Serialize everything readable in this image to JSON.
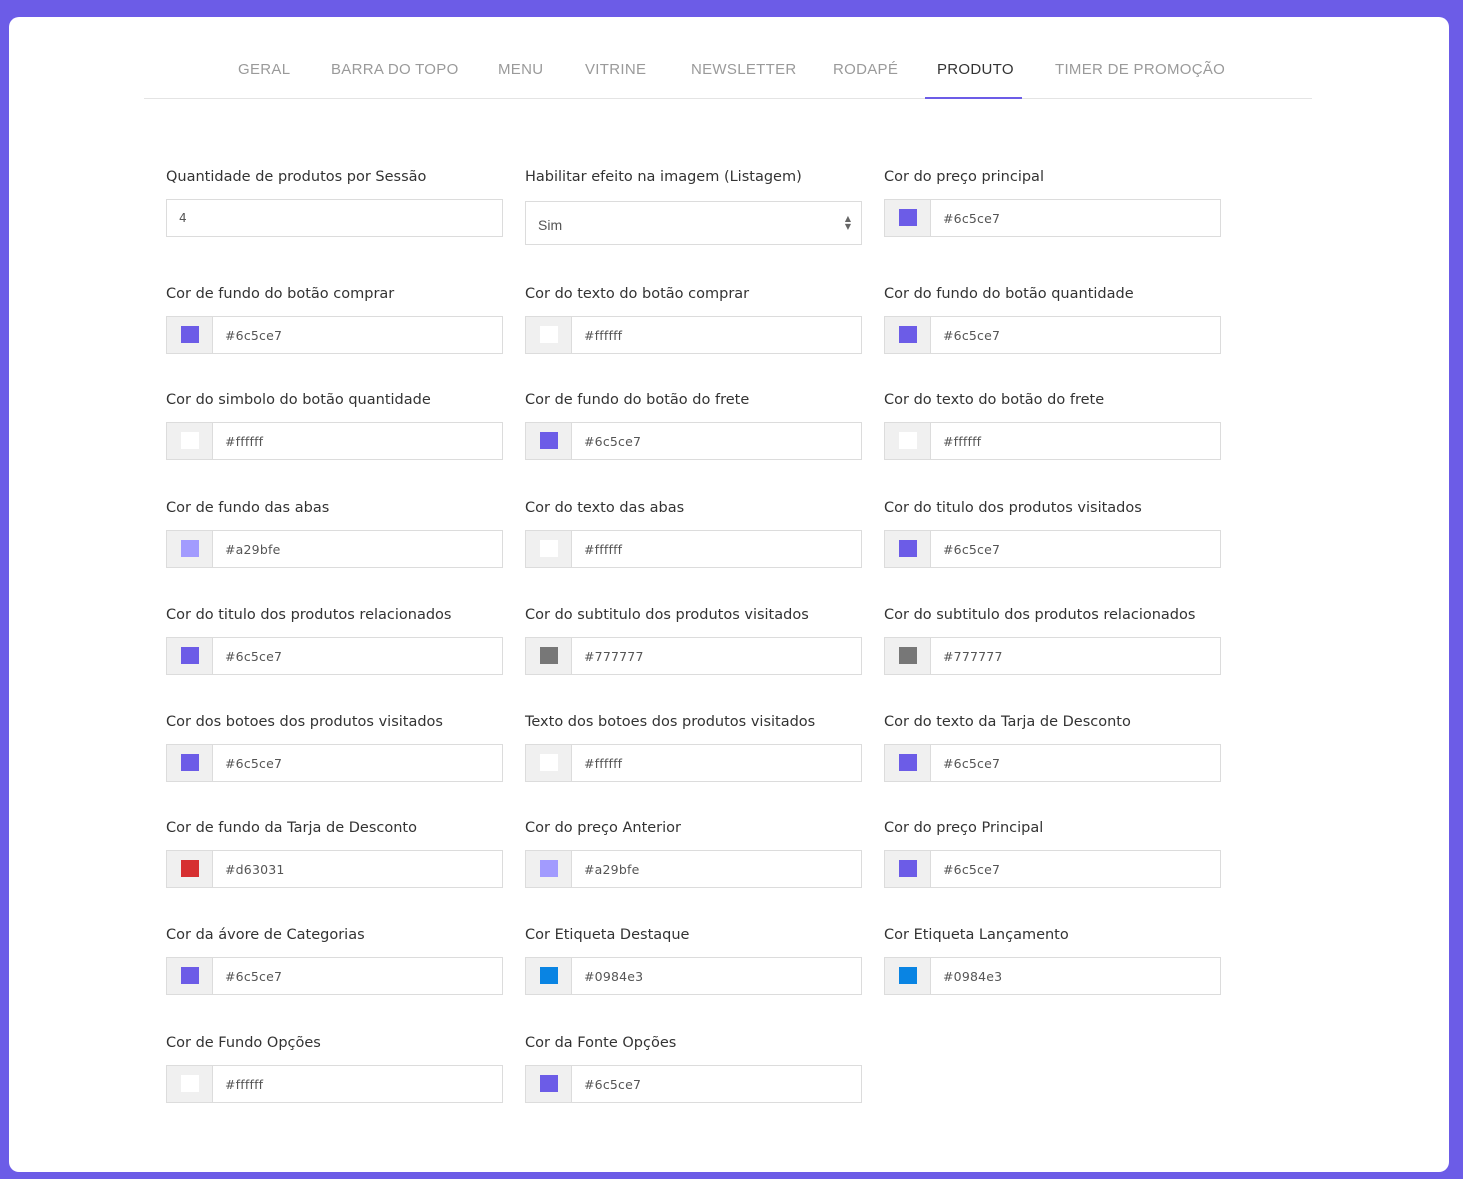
{
  "tabs": [
    {
      "label": "GERAL"
    },
    {
      "label": "BARRA DO TOPO"
    },
    {
      "label": "MENU"
    },
    {
      "label": "VITRINE"
    },
    {
      "label": "NEWSLETTER"
    },
    {
      "label": "RODAPÉ"
    },
    {
      "label": "PRODUTO",
      "active": true
    },
    {
      "label": "TIMER DE PROMOÇÃO"
    }
  ],
  "fields": [
    {
      "label": "Quantidade de produtos por Sessão",
      "type": "text",
      "value": "4"
    },
    {
      "label": "Habilitar efeito na imagem (Listagem)",
      "type": "select",
      "value": "Sim"
    },
    {
      "label": "Cor do preço principal",
      "type": "color",
      "value": "#6c5ce7",
      "color": "#6c5ce7"
    },
    {
      "label": "Cor de fundo do botão comprar",
      "type": "color",
      "value": "#6c5ce7",
      "color": "#6c5ce7"
    },
    {
      "label": "Cor do texto do botão comprar",
      "type": "color",
      "value": "#ffffff",
      "color": "#ffffff"
    },
    {
      "label": "Cor do fundo do botão quantidade",
      "type": "color",
      "value": "#6c5ce7",
      "color": "#6c5ce7"
    },
    {
      "label": "Cor do simbolo do botão quantidade",
      "type": "color",
      "value": "#ffffff",
      "color": "#ffffff"
    },
    {
      "label": "Cor de fundo do botão do frete",
      "type": "color",
      "value": "#6c5ce7",
      "color": "#6c5ce7"
    },
    {
      "label": "Cor do texto do botão do frete",
      "type": "color",
      "value": "#ffffff",
      "color": "#ffffff"
    },
    {
      "label": "Cor de fundo das abas",
      "type": "color",
      "value": "#a29bfe",
      "color": "#a29bfe"
    },
    {
      "label": "Cor do texto das abas",
      "type": "color",
      "value": "#ffffff",
      "color": "#ffffff"
    },
    {
      "label": "Cor do titulo dos produtos visitados",
      "type": "color",
      "value": "#6c5ce7",
      "color": "#6c5ce7"
    },
    {
      "label": "Cor do titulo dos produtos relacionados",
      "type": "color",
      "value": "#6c5ce7",
      "color": "#6c5ce7"
    },
    {
      "label": "Cor do subtitulo dos produtos visitados",
      "type": "color",
      "value": "#777777",
      "color": "#777777"
    },
    {
      "label": "Cor do subtitulo dos produtos relacionados",
      "type": "color",
      "value": "#777777",
      "color": "#777777"
    },
    {
      "label": "Cor dos botoes dos produtos visitados",
      "type": "color",
      "value": "#6c5ce7",
      "color": "#6c5ce7"
    },
    {
      "label": "Texto dos botoes dos produtos visitados",
      "type": "color",
      "value": "#ffffff",
      "color": "#ffffff"
    },
    {
      "label": "Cor do texto da Tarja de Desconto",
      "type": "color",
      "value": "#6c5ce7",
      "color": "#6c5ce7"
    },
    {
      "label": "Cor de fundo da Tarja de Desconto",
      "type": "color",
      "value": "#d63031",
      "color": "#d63031"
    },
    {
      "label": "Cor do preço Anterior",
      "type": "color",
      "value": "#a29bfe",
      "color": "#a29bfe"
    },
    {
      "label": "Cor do preço Principal",
      "type": "color",
      "value": "#6c5ce7",
      "color": "#6c5ce7"
    },
    {
      "label": "Cor da ávore de Categorias",
      "type": "color",
      "value": "#6c5ce7",
      "color": "#6c5ce7"
    },
    {
      "label": "Cor Etiqueta Destaque",
      "type": "color",
      "value": "#0984e3",
      "color": "#0984e3"
    },
    {
      "label": "Cor Etiqueta Lançamento",
      "type": "color",
      "value": "#0984e3",
      "color": "#0984e3"
    },
    {
      "label": "Cor de Fundo Opções",
      "type": "color",
      "value": "#ffffff",
      "color": "#ffffff"
    },
    {
      "label": "Cor da Fonte Opções",
      "type": "color",
      "value": "#6c5ce7",
      "color": "#6c5ce7"
    }
  ]
}
